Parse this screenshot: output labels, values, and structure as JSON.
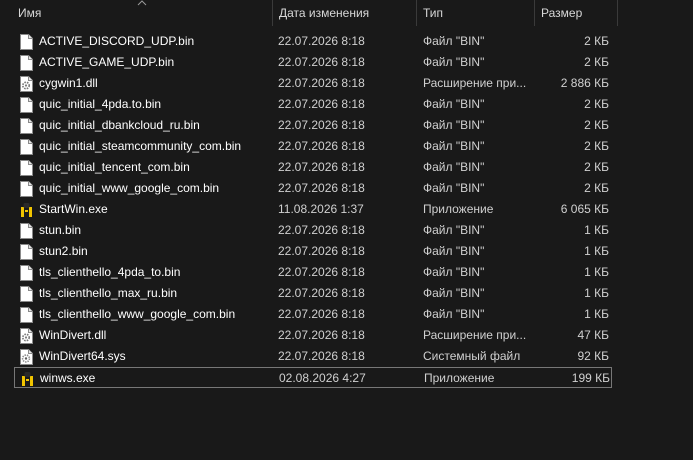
{
  "columns": {
    "name": "Имя",
    "date": "Дата изменения",
    "type": "Тип",
    "size": "Размер"
  },
  "sort": {
    "column": "name",
    "direction": "ascending"
  },
  "files": [
    {
      "name": "ACTIVE_DISCORD_UDP.bin",
      "date": "22.07.2026 8:18",
      "type": "Файл \"BIN\"",
      "size": "2 КБ",
      "icon": "file-icon"
    },
    {
      "name": "ACTIVE_GAME_UDP.bin",
      "date": "22.07.2026 8:18",
      "type": "Файл \"BIN\"",
      "size": "2 КБ",
      "icon": "file-icon"
    },
    {
      "name": "cygwin1.dll",
      "date": "22.07.2026 8:18",
      "type": "Расширение при...",
      "size": "2 886 КБ",
      "icon": "dll-file-icon"
    },
    {
      "name": "quic_initial_4pda.to.bin",
      "date": "22.07.2026 8:18",
      "type": "Файл \"BIN\"",
      "size": "2 КБ",
      "icon": "file-icon"
    },
    {
      "name": "quic_initial_dbankcloud_ru.bin",
      "date": "22.07.2026 8:18",
      "type": "Файл \"BIN\"",
      "size": "2 КБ",
      "icon": "file-icon"
    },
    {
      "name": "quic_initial_steamcommunity_com.bin",
      "date": "22.07.2026 8:18",
      "type": "Файл \"BIN\"",
      "size": "2 КБ",
      "icon": "file-icon"
    },
    {
      "name": "quic_initial_tencent_com.bin",
      "date": "22.07.2026 8:18",
      "type": "Файл \"BIN\"",
      "size": "2 КБ",
      "icon": "file-icon"
    },
    {
      "name": "quic_initial_www_google_com.bin",
      "date": "22.07.2026 8:18",
      "type": "Файл \"BIN\"",
      "size": "2 КБ",
      "icon": "file-icon"
    },
    {
      "name": "StartWin.exe",
      "date": "11.08.2026 1:37",
      "type": "Приложение",
      "size": "6 065 КБ",
      "icon": "exe-app-icon"
    },
    {
      "name": "stun.bin",
      "date": "22.07.2026 8:18",
      "type": "Файл \"BIN\"",
      "size": "1 КБ",
      "icon": "file-icon"
    },
    {
      "name": "stun2.bin",
      "date": "22.07.2026 8:18",
      "type": "Файл \"BIN\"",
      "size": "1 КБ",
      "icon": "file-icon"
    },
    {
      "name": "tls_clienthello_4pda_to.bin",
      "date": "22.07.2026 8:18",
      "type": "Файл \"BIN\"",
      "size": "1 КБ",
      "icon": "file-icon"
    },
    {
      "name": "tls_clienthello_max_ru.bin",
      "date": "22.07.2026 8:18",
      "type": "Файл \"BIN\"",
      "size": "1 КБ",
      "icon": "file-icon"
    },
    {
      "name": "tls_clienthello_www_google_com.bin",
      "date": "22.07.2026 8:18",
      "type": "Файл \"BIN\"",
      "size": "1 КБ",
      "icon": "file-icon"
    },
    {
      "name": "WinDivert.dll",
      "date": "22.07.2026 8:18",
      "type": "Расширение при...",
      "size": "47 КБ",
      "icon": "dll-file-icon"
    },
    {
      "name": "WinDivert64.sys",
      "date": "22.07.2026 8:18",
      "type": "Системный файл",
      "size": "92 КБ",
      "icon": "sys-file-icon"
    },
    {
      "name": "winws.exe",
      "date": "02.08.2026 4:27",
      "type": "Приложение",
      "size": "199 КБ",
      "icon": "exe-app-icon",
      "selected": true
    }
  ]
}
